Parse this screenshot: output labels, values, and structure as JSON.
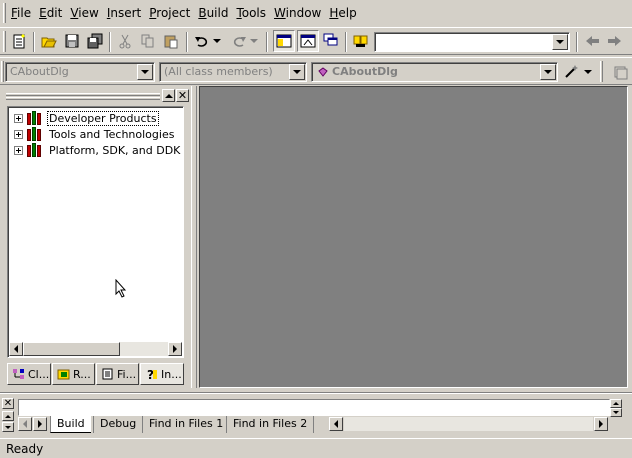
{
  "menu": [
    "File",
    "Edit",
    "View",
    "Insert",
    "Project",
    "Build",
    "Tools",
    "Window",
    "Help"
  ],
  "toolbar": {
    "find_combo_value": "",
    "icons": [
      "new-text-file-icon",
      "open-icon",
      "save-icon",
      "save-all-icon",
      "cut-icon",
      "copy-icon",
      "paste-icon",
      "undo-icon",
      "redo-icon",
      "workspace-icon",
      "output-icon",
      "window-list-icon",
      "find-in-files-icon",
      "back-icon",
      "forward-icon"
    ]
  },
  "wizardbar": {
    "class_combo": "CAboutDlg",
    "filter_combo": "(All class members)",
    "member_combo": "CAboutDlg"
  },
  "workspace": {
    "tree_items": [
      "Developer Products",
      "Tools and Technologies",
      "Platform, SDK, and DDK D"
    ],
    "tabs": [
      "Cl...",
      "R...",
      "Fi...",
      "In..."
    ]
  },
  "output": {
    "tabs": [
      "Build",
      "Debug",
      "Find in Files 1",
      "Find in Files 2"
    ]
  },
  "status": {
    "text": "Ready"
  },
  "colors": {
    "face": "#d4d0c8",
    "mdi_bg": "#808080",
    "tree_bg": "#ffffff"
  }
}
